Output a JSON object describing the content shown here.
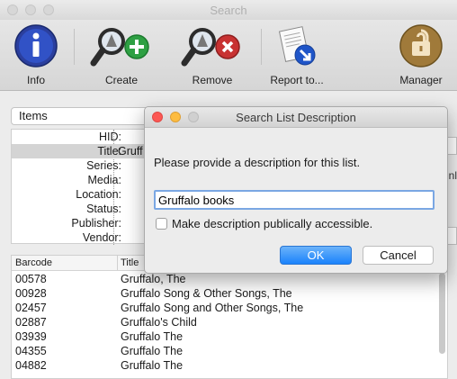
{
  "window": {
    "title": "Search"
  },
  "toolbar": {
    "items": [
      {
        "label": "Info",
        "icon": "info-icon"
      },
      {
        "label": "Create",
        "icon": "magnifier-plus-icon"
      },
      {
        "label": "Remove",
        "icon": "magnifier-remove-icon"
      },
      {
        "label": "Report to...",
        "icon": "report-icon"
      },
      {
        "label": "Manager",
        "icon": "padlock-icon"
      }
    ]
  },
  "main": {
    "search_type": "Items",
    "edge_text": "nl",
    "fields": [
      {
        "label": "HID:",
        "value": ""
      },
      {
        "label": "Title:",
        "value": "Gruff"
      },
      {
        "label": "Series:",
        "value": ""
      },
      {
        "label": "Media:",
        "value": ""
      },
      {
        "label": "Location:",
        "value": ""
      },
      {
        "label": "Status:",
        "value": ""
      },
      {
        "label": "Publisher:",
        "value": ""
      },
      {
        "label": "Vendor:",
        "value": ""
      }
    ],
    "table": {
      "columns": [
        "Barcode",
        "Title"
      ],
      "rows": [
        [
          "00578",
          "Gruffalo, The"
        ],
        [
          "00928",
          "Gruffalo Song & Other Songs, The"
        ],
        [
          "02457",
          "Gruffalo Song and Other Songs, The"
        ],
        [
          "02887",
          "Gruffalo's Child"
        ],
        [
          "03939",
          "Gruffalo The"
        ],
        [
          "04355",
          "Gruffalo The"
        ],
        [
          "04882",
          "Gruffalo The"
        ]
      ]
    }
  },
  "dialog": {
    "title": "Search List Description",
    "prompt": "Please provide a description for this list.",
    "description_value": "Gruffalo books",
    "public_checkbox_label": "Make description publically accessible.",
    "public_checked": false,
    "ok_label": "OK",
    "cancel_label": "Cancel"
  },
  "colors": {
    "accent": "#1a82fb",
    "focus_ring": "#7aa7e3",
    "close": "#fc5753",
    "minimize": "#fdbc40"
  }
}
